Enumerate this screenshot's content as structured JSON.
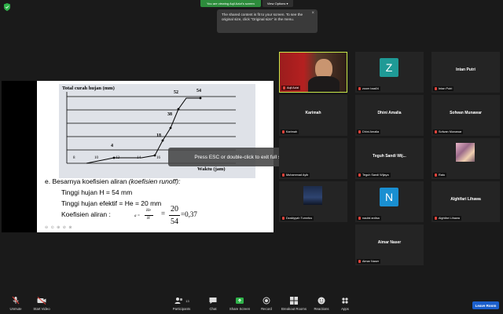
{
  "top": {
    "viewing_text": "You are viewing Aqil Azizi's screen",
    "view_options": "View Options",
    "tooltip_text": "The shared content is fit to your screen. To see the original size, click \"Original size\" in the menu."
  },
  "slide": {
    "y_axis_title": "Total curah hujan (mm)",
    "x_axis_title": "Waktu (jam)",
    "point_labels": [
      "52",
      "54",
      "38",
      "18",
      "4"
    ],
    "x_ticks": [
      "8",
      "10",
      "12",
      "14",
      "16"
    ],
    "line_e": "e. Besarnya koefisien aliran",
    "line_e_italic": "(koefisien runoff):",
    "line_h": "Tinggi hujan H = 54 mm",
    "line_he": "Tinggi hujan efektif = He = 20 mm",
    "line_koef": "Koefisien aliran :",
    "formula_a": "a =",
    "formula_num": "He",
    "formula_den": "H",
    "formula_eq": "=",
    "formula_num2": "20",
    "formula_den2": "54",
    "formula_result": "=0,37",
    "controls": "⊖ ⊙ ⊕ ⊘ ⊗"
  },
  "esc_message": "Press ESC or double-click to exit full screen mode",
  "gallery": [
    {
      "name": "Aqil Azizi",
      "type": "video"
    },
    {
      "name": "zoom baa04",
      "initial": "Z",
      "color": "#1f9a96",
      "type": "avatar"
    },
    {
      "name": "Intan Putri",
      "type": "name"
    },
    {
      "name": "Karimah",
      "type": "name"
    },
    {
      "name": "Dhini Amalia",
      "type": "name"
    },
    {
      "name": "Sofwan Munawar",
      "type": "name"
    },
    {
      "name": "Muhammad Ayib",
      "type": "name"
    },
    {
      "name": "Teguh Sandi Wij...",
      "tag": "Teguh Sandi Wijaya",
      "type": "name"
    },
    {
      "name": "Ratu",
      "type": "photo"
    },
    {
      "name": "Dzakiyyah Tumnfus",
      "type": "photo"
    },
    {
      "name": "naufal ardisa",
      "initial": "N",
      "color": "#1a8fd1",
      "type": "avatar"
    },
    {
      "name": "Alghifari Lihawa",
      "type": "photo"
    },
    {
      "name": "Aimar Naser",
      "type": "name"
    }
  ],
  "toolbar": {
    "unmute": "Unmute",
    "start_video": "Start Video",
    "participants": "Participants",
    "participant_count": "13",
    "chat": "Chat",
    "share_screen": "Share Screen",
    "record": "Record",
    "breakout": "Breakout Rooms",
    "reactions": "Reactions",
    "apps": "Apps",
    "leave": "Leave Room"
  },
  "colors": {
    "active_border": "#c7e84a",
    "share_green": "#2d8c3c",
    "leave_blue": "#1b5fcc",
    "mic_muted": "#e0433b"
  }
}
